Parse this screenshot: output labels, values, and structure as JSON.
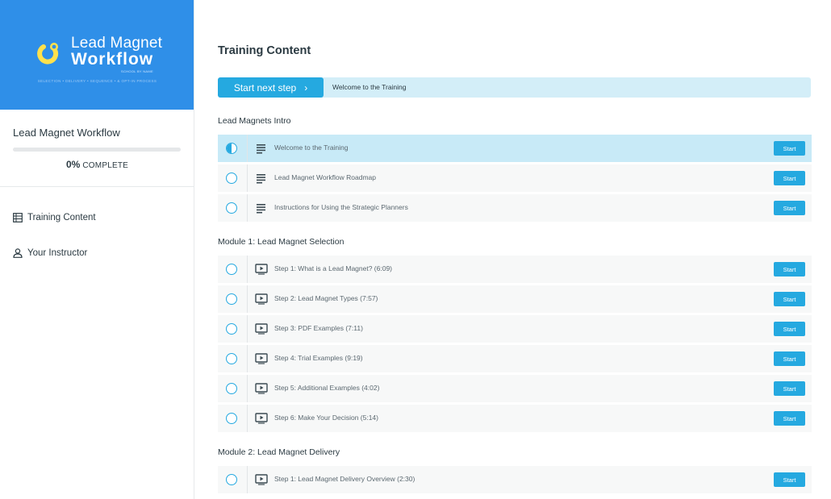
{
  "brand": {
    "line1": "Lead Magnet",
    "line2": "Workflow",
    "byline": "SCHOOL BY NAME",
    "tagline": "SELECTION • DELIVERY • SEQUENCE • & OPT-IN PROCESS"
  },
  "sidebar": {
    "course_title": "Lead Magnet Workflow",
    "progress_value": 0,
    "progress_pct": "0%",
    "progress_label": "COMPLETE",
    "nav": [
      {
        "label": "Training Content",
        "icon": "table-of-contents-icon"
      },
      {
        "label": "Your Instructor",
        "icon": "person-icon"
      }
    ]
  },
  "main": {
    "title": "Training Content",
    "next_button": "Start next step",
    "next_lesson": "Welcome to the Training",
    "sections": [
      {
        "title": "Lead Magnets Intro",
        "lessons": [
          {
            "name": "Welcome to the Training",
            "type": "text",
            "status": "in-progress",
            "button": "Start"
          },
          {
            "name": "Lead Magnet Workflow Roadmap",
            "type": "text",
            "status": "not-started",
            "button": "Start"
          },
          {
            "name": "Instructions for Using the Strategic Planners",
            "type": "text",
            "status": "not-started",
            "button": "Start"
          }
        ]
      },
      {
        "title": "Module 1: Lead Magnet Selection",
        "lessons": [
          {
            "name": "Step 1: What is a Lead Magnet? (6:09)",
            "type": "video",
            "status": "not-started",
            "button": "Start"
          },
          {
            "name": "Step 2: Lead Magnet Types (7:57)",
            "type": "video",
            "status": "not-started",
            "button": "Start"
          },
          {
            "name": "Step 3: PDF Examples (7:11)",
            "type": "video",
            "status": "not-started",
            "button": "Start"
          },
          {
            "name": "Step 4: Trial Examples (9:19)",
            "type": "video",
            "status": "not-started",
            "button": "Start"
          },
          {
            "name": "Step 5: Additional Examples (4:02)",
            "type": "video",
            "status": "not-started",
            "button": "Start"
          },
          {
            "name": "Step 6: Make Your Decision (5:14)",
            "type": "video",
            "status": "not-started",
            "button": "Start"
          }
        ]
      },
      {
        "title": "Module 2: Lead Magnet Delivery",
        "lessons": [
          {
            "name": "Step 1: Lead Magnet Delivery Overview (2:30)",
            "type": "video",
            "status": "not-started",
            "button": "Start"
          }
        ]
      }
    ]
  },
  "colors": {
    "brand_blue": "#2f8fe8",
    "accent": "#25a9e0",
    "active_row": "#c8eaf7",
    "next_bar": "#d3eef8"
  }
}
